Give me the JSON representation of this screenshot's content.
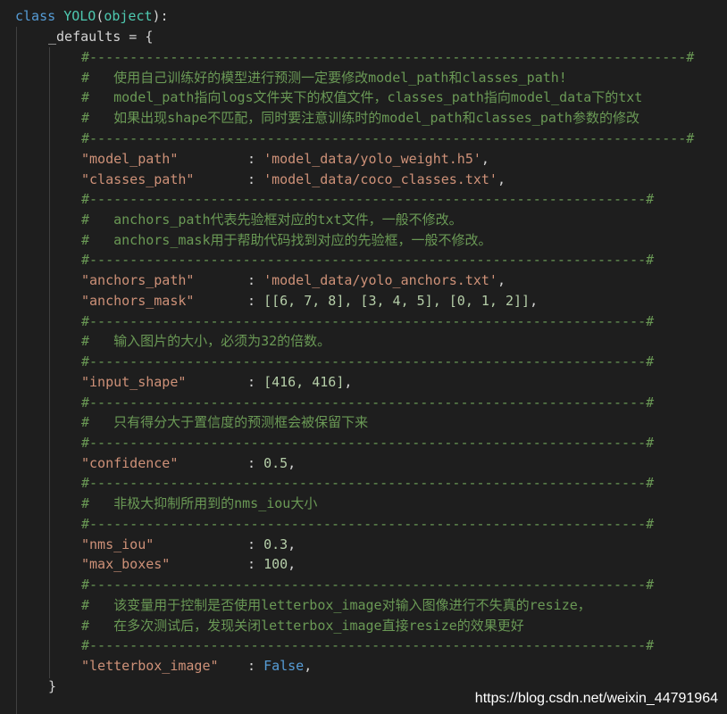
{
  "code": {
    "class_kw": "class",
    "class_name": "YOLO",
    "paren_open": "(",
    "base": "object",
    "paren_close": "):",
    "defaults_name": "_defaults",
    "defaults_eq": " = {",
    "close_brace": "}",
    "sep_long": "#--------------------------------------------------------------------------#",
    "sep_short": "#---------------------------------------------------------------------#",
    "comments": {
      "c1": "#   使用自己训练好的模型进行预测一定要修改model_path和classes_path!",
      "c2": "#   model_path指向logs文件夹下的权值文件，classes_path指向model_data下的txt",
      "c3": "#   如果出现shape不匹配，同时要注意训练时的model_path和classes_path参数的修改",
      "c4": "#   anchors_path代表先验框对应的txt文件，一般不修改。",
      "c5": "#   anchors_mask用于帮助代码找到对应的先验框，一般不修改。",
      "c6": "#   输入图片的大小，必须为32的倍数。",
      "c7": "#   只有得分大于置信度的预测框会被保留下来",
      "c8": "#   非极大抑制所用到的nms_iou大小",
      "c9": "#   该变量用于控制是否使用letterbox_image对输入图像进行不失真的resize，",
      "c10": "#   在多次测试后，发现关闭letterbox_image直接resize的效果更好"
    },
    "entries": {
      "model_path_key": "\"model_path\"",
      "model_path_val": "'model_data/yolo_weight.h5'",
      "classes_path_key": "\"classes_path\"",
      "classes_path_val": "'model_data/coco_classes.txt'",
      "anchors_path_key": "\"anchors_path\"",
      "anchors_path_val": "'model_data/yolo_anchors.txt'",
      "anchors_mask_key": "\"anchors_mask\"",
      "anchors_mask_val": "[[6, 7, 8], [3, 4, 5], [0, 1, 2]]",
      "input_shape_key": "\"input_shape\"",
      "input_shape_val": "[416, 416]",
      "confidence_key": "\"confidence\"",
      "confidence_val": "0.5",
      "nms_iou_key": "\"nms_iou\"",
      "nms_iou_val": "0.3",
      "max_boxes_key": "\"max_boxes\"",
      "max_boxes_val": "100",
      "letterbox_key": "\"letterbox_image\"",
      "letterbox_val": "False"
    },
    "colon": ": ",
    "comma": ","
  },
  "watermark": "https://blog.csdn.net/weixin_44791964"
}
